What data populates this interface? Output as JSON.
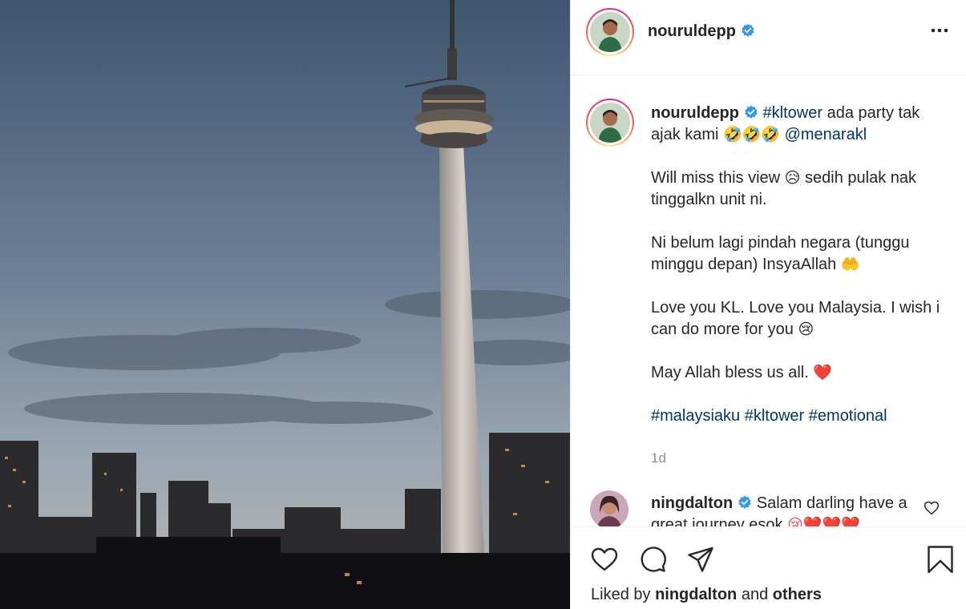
{
  "post": {
    "username": "nouruldepp",
    "verified": true,
    "more_icon": "more-horizontal-icon"
  },
  "caption": {
    "line1_tag": "#kltower",
    "line1_text": " ada party tak ajak kami ",
    "line1_emoji": "🤣🤣🤣",
    "line1_mention": "@menarakl",
    "p2_a": "Will miss this view ",
    "p2_emoji": "😥",
    "p2_b": " sedih pulak nak tinggalkn unit ni.",
    "p3_a": "Ni belum lagi pindah negara (tunggu minggu depan) InsyaAllah ",
    "p3_emoji": "🤲",
    "p4_a": "Love you KL. Love you Malaysia. I wish i can do more for you ",
    "p4_emoji": "😢",
    "p5_a": "May Allah bless us all. ",
    "p5_emoji": "❤️",
    "tags": [
      "#malaysiaku",
      "#kltower",
      "#emotional"
    ],
    "time": "1d"
  },
  "comment": {
    "username": "ningdalton",
    "verified": true,
    "text": " Salam darling have a great journey esok ",
    "emoji": "😢❤️❤️❤️"
  },
  "actions": {
    "like_icon": "heart-icon",
    "comment_icon": "comment-icon",
    "share_icon": "share-icon",
    "save_icon": "bookmark-icon"
  },
  "likes": {
    "prefix": "Liked by ",
    "user": "ningdalton",
    "middle": " and ",
    "others": "others"
  },
  "colors": {
    "link": "#00376b",
    "verified": "#3897f0",
    "heart": "#ed4956",
    "muted": "#8e8e8e"
  }
}
